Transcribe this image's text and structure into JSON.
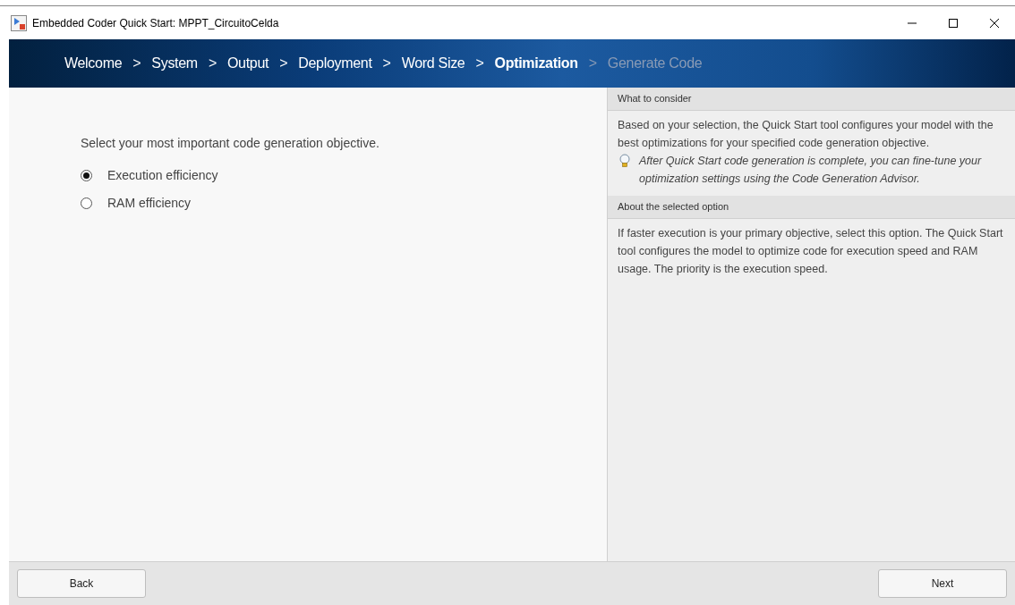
{
  "window": {
    "title": "Embedded Coder Quick Start: MPPT_CircuitoCelda"
  },
  "steps": [
    {
      "label": "Welcome",
      "selected": false,
      "disabled": false
    },
    {
      "separator": ">",
      "label": "System",
      "selected": false,
      "disabled": false
    },
    {
      "separator": ">",
      "label": "Output",
      "selected": false,
      "disabled": false
    },
    {
      "separator": ">",
      "label": "Deployment",
      "selected": false,
      "disabled": false
    },
    {
      "separator": ">",
      "label": "Word Size",
      "selected": false,
      "disabled": false
    },
    {
      "separator": ">",
      "label": "Optimization",
      "selected": true,
      "disabled": false
    },
    {
      "separator": ">",
      "label": "Generate Code",
      "selected": false,
      "disabled": true
    }
  ],
  "prompt": "Select your most important code generation objective.",
  "options": [
    {
      "label": "Execution efficiency",
      "selected": true
    },
    {
      "label": "RAM efficiency",
      "selected": false
    }
  ],
  "info": [
    {
      "heading": "What to consider",
      "text": "Based on your selection, the Quick Start tool configures your model with the best optimizations for your specified code generation objective.",
      "tip": "After Quick Start code generation is complete, you can fine-tune your optimization settings using the Code Generation Advisor."
    },
    {
      "heading": "About the selected option",
      "text": "If faster execution is your primary objective, select this option. The Quick Start tool configures the model to optimize code for execution speed and RAM usage. The priority is the execution speed."
    }
  ],
  "buttons": {
    "back": "Back",
    "next": "Next"
  }
}
